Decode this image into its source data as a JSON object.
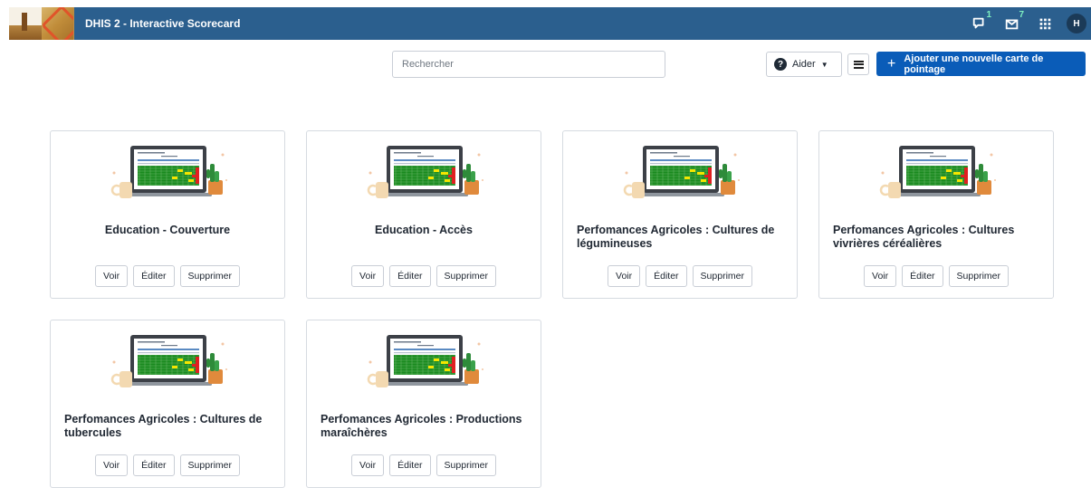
{
  "header": {
    "title": "DHIS 2 - Interactive Scorecard",
    "interpretations_count": "1",
    "messages_count": "7",
    "user_initial": "H"
  },
  "toolbar": {
    "search_placeholder": "Rechercher",
    "help_label": "Aider",
    "add_label": "Ajouter une nouvelle carte de pointage"
  },
  "cards": [
    {
      "title": "Education - Couverture",
      "view": "Voir",
      "edit": "Éditer",
      "delete": "Supprimer"
    },
    {
      "title": "Education - Accès",
      "view": "Voir",
      "edit": "Éditer",
      "delete": "Supprimer"
    },
    {
      "title": "Perfomances Agricoles : Cultures de légumineuses",
      "view": "Voir",
      "edit": "Éditer",
      "delete": "Supprimer"
    },
    {
      "title": "Perfomances Agricoles : Cultures vivrières céréalières",
      "view": "Voir",
      "edit": "Éditer",
      "delete": "Supprimer"
    },
    {
      "title": "Perfomances Agricoles : Cultures de tubercules",
      "view": "Voir",
      "edit": "Éditer",
      "delete": "Supprimer"
    },
    {
      "title": "Perfomances Agricoles : Productions maraîchères",
      "view": "Voir",
      "edit": "Éditer",
      "delete": "Supprimer"
    }
  ],
  "colors": {
    "header_bg": "#2b5f8e",
    "primary_button": "#0a5cb8",
    "badge": "#7ef0c0"
  }
}
